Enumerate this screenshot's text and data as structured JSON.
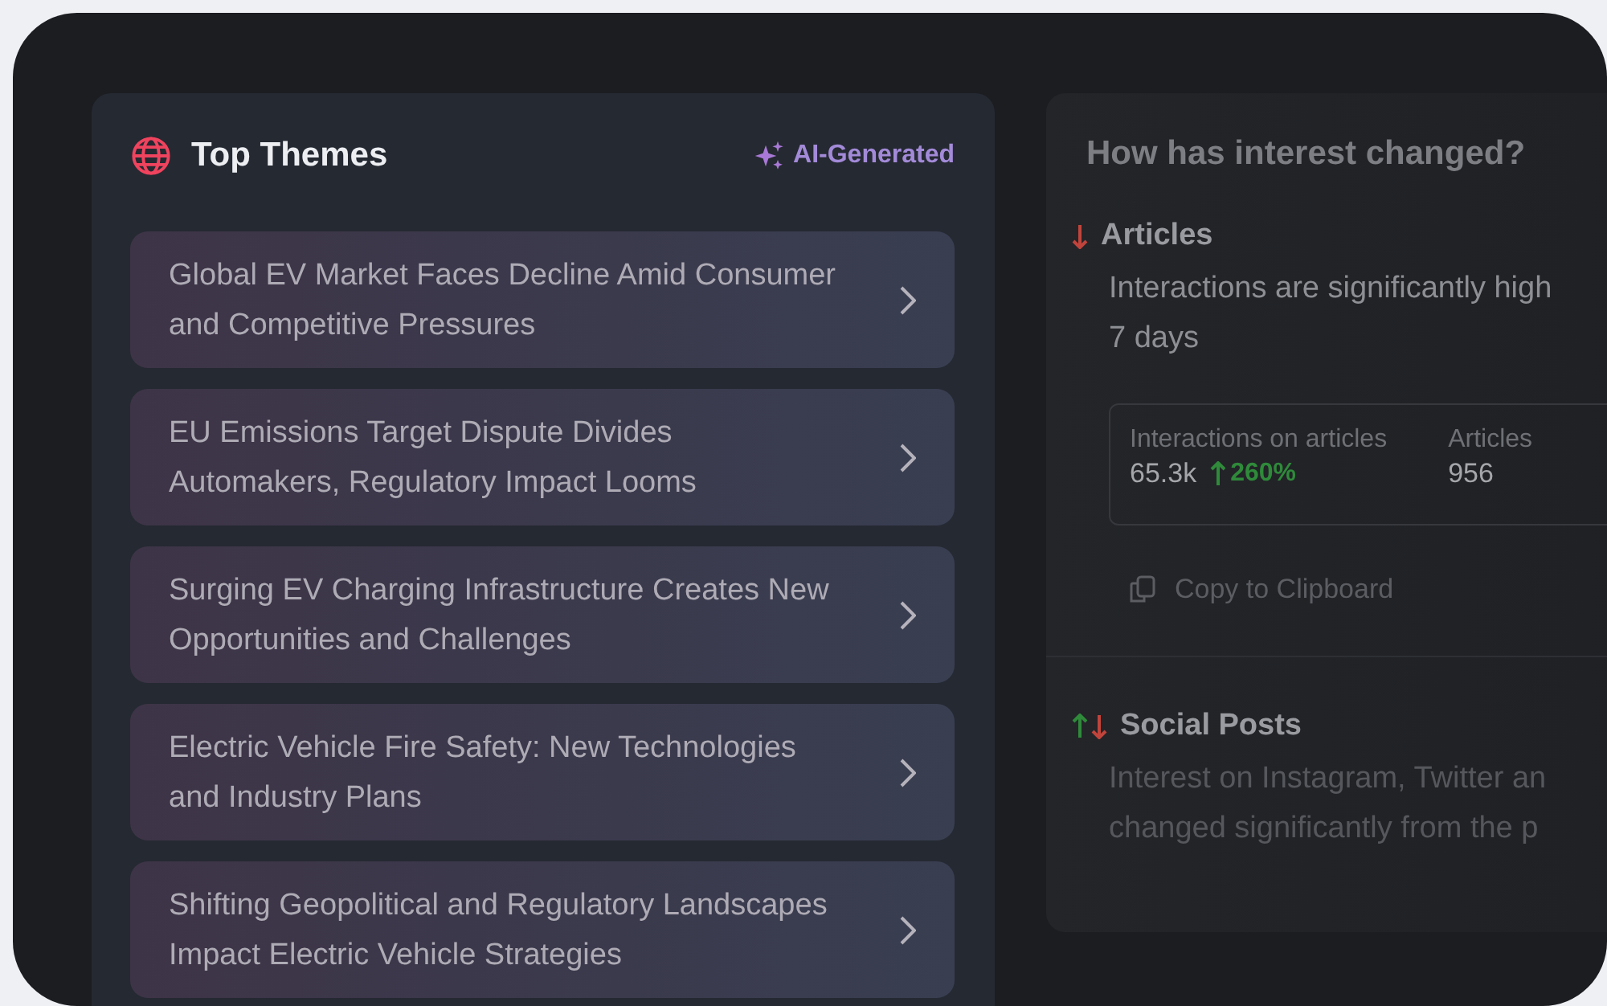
{
  "top_themes": {
    "title": "Top Themes",
    "badge": "AI-Generated",
    "items": [
      {
        "title": "Global EV Market Faces Decline Amid Consumer and Competitive Pressures"
      },
      {
        "title": "EU Emissions Target Dispute Divides Automakers, Regulatory Impact Looms"
      },
      {
        "title": "Surging EV Charging Infrastructure Creates New Opportunities and Challenges"
      },
      {
        "title": "Electric Vehicle Fire Safety: New Technologies and Industry Plans"
      },
      {
        "title": "Shifting Geopolitical and Regulatory Landscapes Impact Electric Vehicle Strategies"
      }
    ]
  },
  "interest": {
    "title": "How has interest changed?",
    "sections": [
      {
        "kind": "down",
        "title": "Articles",
        "lines": [
          "Interactions are significantly high",
          "7 days"
        ],
        "stats": [
          {
            "label": "Interactions on articles",
            "value": "65.3k",
            "change": "260%"
          },
          {
            "label": "Articles",
            "value": "956"
          }
        ],
        "action": "Copy to Clipboard"
      },
      {
        "kind": "mixed",
        "title": "Social Posts",
        "lines": [
          "Interest on Instagram, Twitter an",
          "changed significantly from the p"
        ]
      }
    ]
  }
}
